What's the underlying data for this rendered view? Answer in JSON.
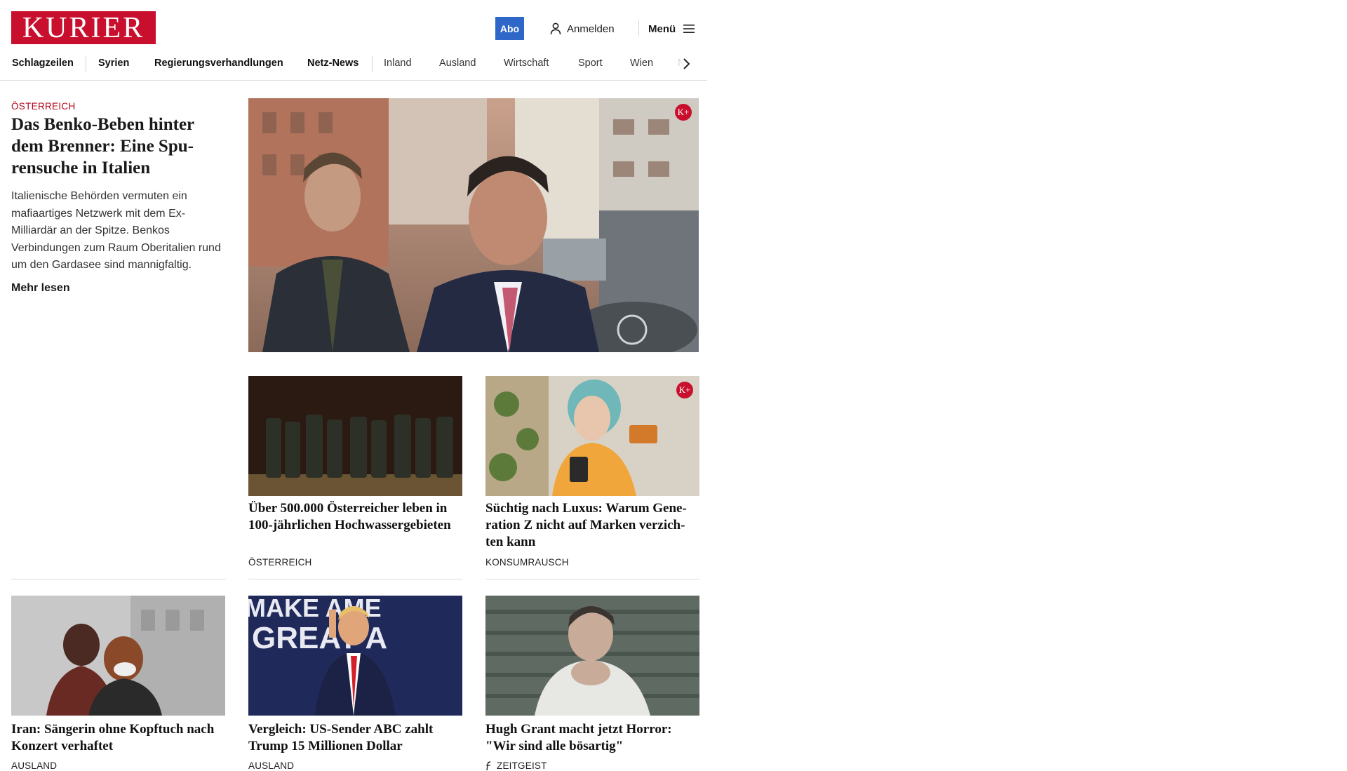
{
  "header": {
    "logo": "KURIER",
    "abo_label": "Abo",
    "login_label": "Anmelden",
    "menu_label": "Menü",
    "icons": [
      "user-icon",
      "hamburger-icon"
    ],
    "brand_color": "#c8102e",
    "abo_color": "#2e67c8"
  },
  "nav": {
    "items": [
      "Schlagzeilen",
      "Syrien",
      "Regierungsverhandlungen",
      "Netz-News",
      "Inland",
      "Ausland",
      "Wirtschaft",
      "Sport",
      "Wien",
      "NÖ"
    ],
    "next_icon": "chevron-right-icon"
  },
  "lead": {
    "kicker": "ÖSTERREICH",
    "title": "Das Benko-Beben hinter dem Brenner: Eine Spu-rensuche in Italien",
    "teaser": "Italienische Behörden vermuten ein mafiaartiges Netzwerk mit dem Ex-Milliardär an der Spitze. Benkos Verbindungen zum Raum Oberitalien rund um den Gardasee sind mannigfaltig.",
    "more": "Mehr lesen",
    "premium_badge": "K+"
  },
  "cards": [
    {
      "title": "Über 500.000 Österreicher leben in 100-jährlichen Hochwassergebieten",
      "category": "ÖSTERREICH",
      "premium": false
    },
    {
      "title": "Süchtig nach Luxus: Warum Gene-ration Z nicht auf Marken verzich-ten kann",
      "category": "KONSUMRAUSCH",
      "premium": true,
      "badge": "K+"
    },
    {
      "title": "Iran: Sängerin ohne Kopftuch nach Konzert verhaftet",
      "category": "AUSLAND",
      "premium": false
    },
    {
      "title": "Vergleich: US-Sender ABC zahlt Trump 15 Millionen Dollar",
      "category": "AUSLAND",
      "premium": false
    },
    {
      "title": "Hugh Grant macht jetzt Horror: \"Wir sind alle bösartig\"",
      "category": "ZEITGEIST",
      "category_icon": "zeitgeist-icon",
      "premium": false
    }
  ]
}
